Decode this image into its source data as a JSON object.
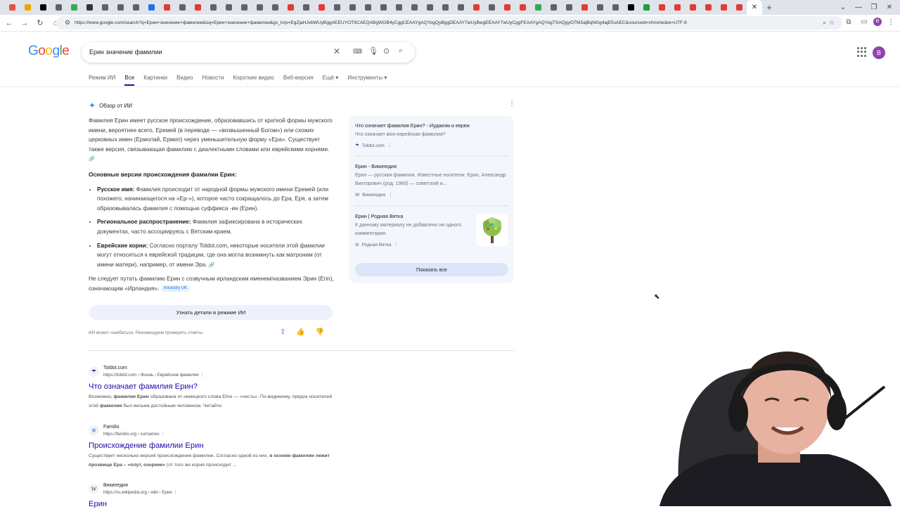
{
  "browser": {
    "url": "https://www.google.com/search?q=Ерин+значение+фамилии&oq=Ерин+значение+фамилии&gs_lcrp=EgZjaHJvbWUyBggAEEUYOTIICAEQABgWGB4yCggCEAAYgAQYogQyBggDEAAY7wUyBwgEEAAY7wUyCggFEAAYgAQYogTSAQgyOTM3ajBqNGg4ajE5sAEC&sourceid=chrome&ie=UTF-8",
    "active_tab_close": "✕",
    "new_tab": "+",
    "tab_favicons": [
      "#e5533d",
      "#f4a300",
      "#000000",
      "#5f6368",
      "#34a853",
      "#333333",
      "#5f6368",
      "#5f6368",
      "#5f6368",
      "#1a73e8",
      "#e53935",
      "#5f6368",
      "#e53935",
      "#5f6368",
      "#5f6368",
      "#5f6368",
      "#5f6368",
      "#5f6368",
      "#e53935",
      "#5f6368",
      "#e53935",
      "#5f6368",
      "#5f6368",
      "#5f6368",
      "#5f6368",
      "#5f6368",
      "#5f6368",
      "#5f6368",
      "#5f6368",
      "#5f6368",
      "#e53935",
      "#5f6368",
      "#e53935",
      "#e53935",
      "#34a853",
      "#5f6368",
      "#5f6368",
      "#e53935",
      "#5f6368",
      "#5f6368",
      "#000000",
      "#1b9e3e",
      "#e53935",
      "#e53935",
      "#e53935",
      "#e53935",
      "#e53935",
      "#e53935"
    ]
  },
  "google": {
    "logo": "Google",
    "query": "Ерин значение фамилии",
    "avatar_letter": "B",
    "tabs": [
      "Режим ИИ",
      "Все",
      "Картинки",
      "Видео",
      "Новости",
      "Короткие видео",
      "Веб-версия",
      "Ещё ▾",
      "Инструменты ▾"
    ]
  },
  "ai_overview": {
    "label": "Обзор от ИИ",
    "intro": "Фамилия Ерин имеет русское происхождение, образовавшись от краткой формы мужского имени, вероятнее всего, Еремей (в переводе — «возвышенный Богом») или схожих церковных имен (Ермолай, Ермил) через уменьшительную форму «Ера». Существует также версия, связывающая фамилию с диалектными словами или еврейскими корнями.",
    "versions_heading": "Основные версии происхождения фамилии Ерин:",
    "bullets": [
      {
        "bold": "Русское имя:",
        "text": " Фамилия происходит от народной формы мужского имени Еремей (или похожего, начинающегося на «Ер-»), которое часто сокращалось до Ера, Еря, а затем образовывалась фамилия с помощью суффикса -ин (Ерин)."
      },
      {
        "bold": "Региональное распространение:",
        "text": " Фамилия зафиксирована в исторических документах, часто ассоциируясь с Вятским краем."
      },
      {
        "bold": "Еврейские корни:",
        "text": " Согласно порталу Toldot.com, некоторые носители этой фамилии могут относиться к еврейской традиции, где она могла возникнуть как матроним (от имени матери), например, от имени Эра."
      }
    ],
    "note": "Не следует путать фамилию Ерин с созвучным ирландским именем/названием Эрин (Erin), означающим «Ирландия».",
    "note_chip": "Ancestry UK",
    "cta": "Узнать детали в режиме ИИ",
    "disclaimer": "ИИ может ошибаться. Рекомендуем проверять ответы."
  },
  "sources": {
    "items": [
      {
        "title": "Что означает фамилия Ерин? - Иудаизм и евреи",
        "snippet": "Что означает моя еврейская фамилия?",
        "site": "Toldot.com"
      },
      {
        "title": "Ерин - Википедия",
        "snippet": "Ерин — русская фамилия. Известные носители: Ерин, Александр Викторович (род. 1960) — советский и...",
        "site": "Википедия"
      },
      {
        "title": "Ерин | Родная Вятка",
        "snippet": "К данному материалу не добавлено ни одного комментария.",
        "site": "Родная Вятка"
      }
    ],
    "show_all": "Показать все"
  },
  "results": [
    {
      "site": "Toldot.com",
      "crumb": "https://toldot.com › Жизнь › Еврейские фамилии",
      "title": "Что означает фамилия Ерин?",
      "snippet": "Возможно, фамилия Ерин образована от немецкого слова Ehre — «честь». По-видимому, предок носителей этой фамилии был весьма достойным человеком. Читайте:"
    },
    {
      "site": "Familio",
      "crumb": "https://familio.org › surnames",
      "title": "Происхождение фамилии Ерин",
      "snippet": "Существует несколько версий происхождения фамилии. Согласно одной из них, в основе фамилии лежит прозвище Ера – «плут, озорник» (от того же корня происходит ..."
    },
    {
      "site": "Википедия",
      "crumb": "https://ru.wikipedia.org › wiki › Ерин",
      "title": "Ерин",
      "snippet": ""
    }
  ]
}
